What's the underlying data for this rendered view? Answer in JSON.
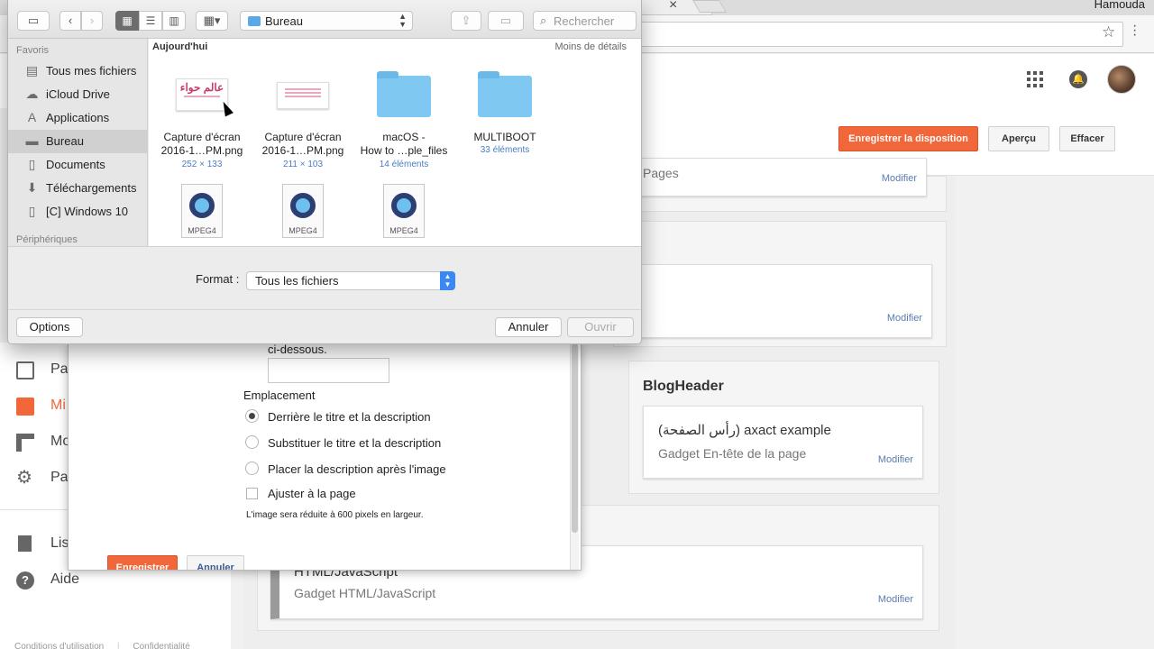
{
  "chrome": {
    "user_name": "Hamouda",
    "tab_close": "×"
  },
  "blogger": {
    "buttons": {
      "save_layout": "Enregistrer la disposition",
      "preview": "Aperçu",
      "clear": "Effacer"
    },
    "nav": [
      {
        "label": "Pa",
        "icon": "pages-icon"
      },
      {
        "label": "Mi",
        "icon": "layout-icon"
      },
      {
        "label": "Mo",
        "icon": "theme-icon"
      },
      {
        "label": "Pa",
        "icon": "settings-icon"
      },
      {
        "label": "Lis",
        "icon": "reading-list-icon"
      },
      {
        "label": "Aide",
        "icon": "help-icon"
      }
    ],
    "footer": {
      "terms": "Conditions d'utilisation",
      "privacy": "Confidentialité"
    },
    "gadgets": {
      "pages_partial": "Pages",
      "modify": "Modifier",
      "blogheader_section": "BlogHeader",
      "blogheader_title": "(رأس الصفحة) axact example",
      "blogheader_sub": "Gadget En-tête de la page",
      "html_title": "HTML/JavaScript",
      "html_sub": "Gadget HTML/JavaScript"
    },
    "modal": {
      "below_text": "ci-dessous.",
      "placement_label": "Emplacement",
      "options": [
        {
          "label": "Derrière le titre et la description",
          "selected": true
        },
        {
          "label": "Substituer le titre et la description",
          "selected": false
        },
        {
          "label": "Placer la description après l'image",
          "selected": false
        }
      ],
      "fit_label": "Ajuster à la page",
      "fit_checked": false,
      "resize_note": "L'image sera réduite à 600  pixels en largeur.",
      "save": "Enregistrer",
      "cancel": "Annuler"
    }
  },
  "dialog": {
    "location": "Bureau",
    "search_placeholder": "Rechercher",
    "sidebar": {
      "favorites_header": "Favoris",
      "devices_header": "Périphériques",
      "items": [
        {
          "label": "Tous mes fichiers",
          "icon": "all-files-icon",
          "selected": false
        },
        {
          "label": "iCloud Drive",
          "icon": "cloud-icon",
          "selected": false
        },
        {
          "label": "Applications",
          "icon": "applications-icon",
          "selected": false
        },
        {
          "label": "Bureau",
          "icon": "desktop-icon",
          "selected": true
        },
        {
          "label": "Documents",
          "icon": "document-icon",
          "selected": false
        },
        {
          "label": "Téléchargements",
          "icon": "download-icon",
          "selected": false
        },
        {
          "label": "[C] Windows 10",
          "icon": "disk-icon",
          "selected": false
        }
      ]
    },
    "content": {
      "group": "Aujourd'hui",
      "less_details": "Moins de détails",
      "files": [
        {
          "line1": "Capture d'écran",
          "line2": "2016-1…PM.png",
          "meta": "252 × 133",
          "kind": "image"
        },
        {
          "line1": "Capture d'écran",
          "line2": "2016-1…PM.png",
          "meta": "211 × 103",
          "kind": "image"
        },
        {
          "line1": "macOS -",
          "line2": "How to …ple_files",
          "meta": "14 éléments",
          "kind": "folder"
        },
        {
          "line1": "MULTIBOOT",
          "line2": "",
          "meta": "33 éléments",
          "kind": "folder"
        }
      ],
      "movies": [
        {
          "label": "MPEG4"
        },
        {
          "label": "MPEG4"
        },
        {
          "label": "MPEG4"
        }
      ],
      "thumb_text": "عالم حواء"
    },
    "format_label": "Format :",
    "format_value": "Tous les fichiers",
    "buttons": {
      "options": "Options",
      "cancel": "Annuler",
      "open": "Ouvrir"
    }
  },
  "colors": {
    "accent": "#f1673a",
    "selection": "#3b88f5",
    "folder": "#7ec8f2"
  }
}
